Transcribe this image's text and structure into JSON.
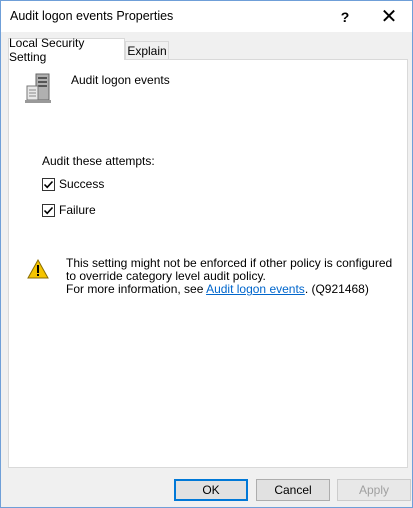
{
  "window": {
    "title": "Audit logon events Properties",
    "help_glyph": "?",
    "close_glyph": "✕"
  },
  "tabs": [
    {
      "label": "Local Security Setting",
      "active": true
    },
    {
      "label": "Explain",
      "active": false
    }
  ],
  "policy": {
    "icon": "server-policy-icon",
    "name": "Audit logon events"
  },
  "audit": {
    "group_label": "Audit these attempts:",
    "options": [
      {
        "label": "Success",
        "checked": true
      },
      {
        "label": "Failure",
        "checked": true
      }
    ]
  },
  "warning": {
    "icon": "warning-triangle-icon",
    "line1": "This setting might not be enforced if other policy is configured to override category level audit policy.",
    "line2_prefix": "For more information, see ",
    "link_text": "Audit logon events",
    "line2_suffix": ". (Q921468)"
  },
  "buttons": {
    "ok": "OK",
    "cancel": "Cancel",
    "apply": "Apply",
    "apply_enabled": false
  },
  "colors": {
    "link": "#0066cc",
    "focus_border": "#0078d7",
    "warning_fill": "#f5c400"
  }
}
